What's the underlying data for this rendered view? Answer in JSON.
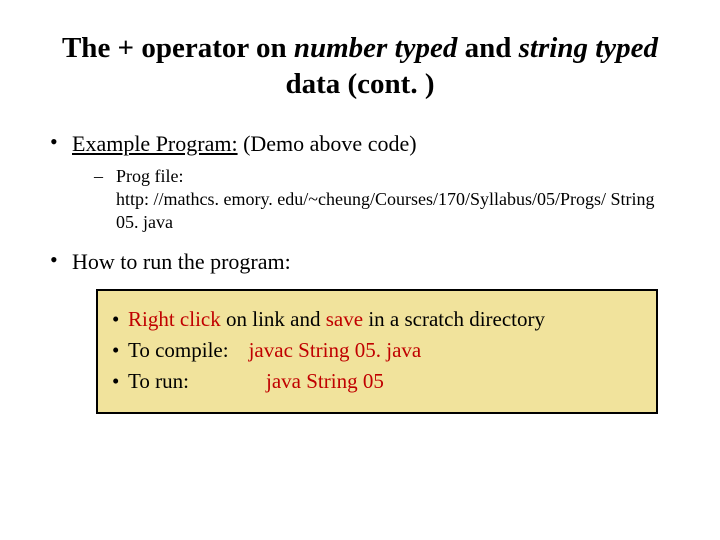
{
  "title": {
    "pre": "The + operator on ",
    "em1": "number typed",
    "mid": " and ",
    "em2": "string typed",
    "post": " data (cont. )"
  },
  "bullets": {
    "example_label": "Example Program:",
    "example_rest": " (Demo above code)",
    "prog_file_label": "Prog file:",
    "prog_file_url": "http: //mathcs. emory. edu/~cheung/Courses/170/Syllabus/05/Progs/ String 05. java",
    "howto": "How to run the program:"
  },
  "box": {
    "row1": {
      "a": "Right click",
      "b": " on link and ",
      "c": "save",
      "d": " in a scratch directory"
    },
    "row2": {
      "label": "To compile:",
      "cmd": "javac String 05. java"
    },
    "row3": {
      "label": "To run:",
      "cmd": "java String 05"
    }
  }
}
